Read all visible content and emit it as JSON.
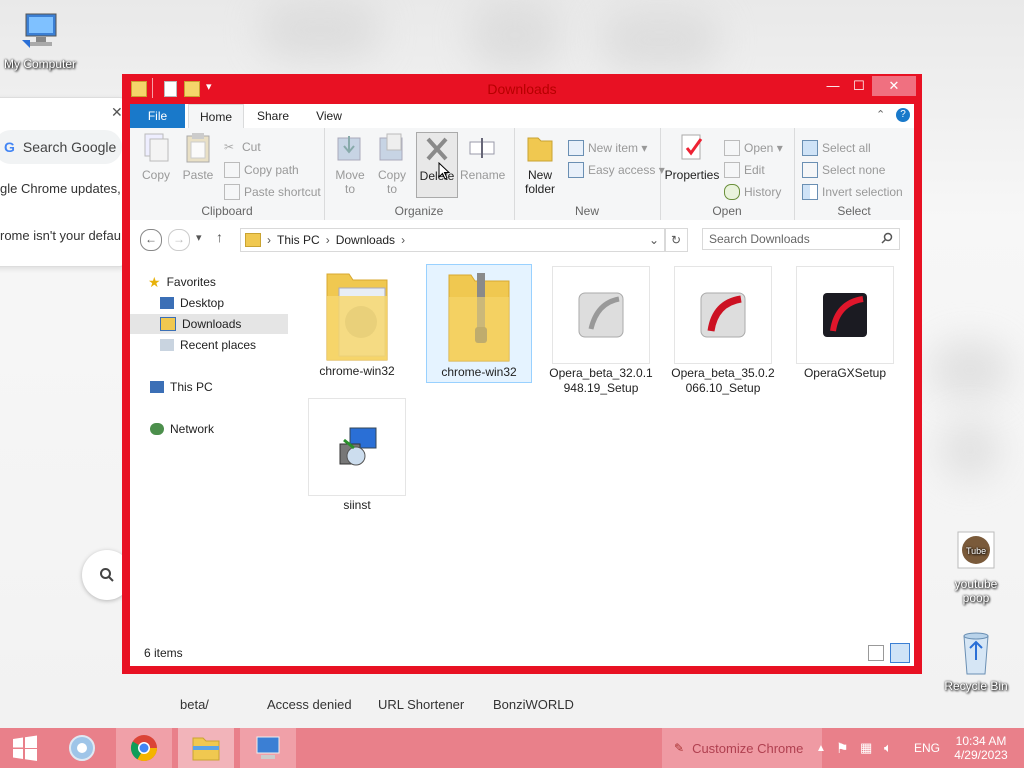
{
  "desktop": {
    "icons": [
      {
        "label": "My Computer"
      },
      {
        "label": "youtube poop"
      },
      {
        "label": "Recycle Bin"
      }
    ]
  },
  "background_chrome": {
    "search_placeholder": "Search Google",
    "line1": "gle Chrome updates,",
    "line2": "rome isn't your defau",
    "close_glyph": "✕",
    "shortcuts": [
      "beta/",
      "Access denied",
      "URL Shortener",
      "BonziWORLD"
    ]
  },
  "window": {
    "title": "Downloads",
    "accent_color": "#e81123",
    "tabs": {
      "file": "File",
      "home": "Home",
      "share": "Share",
      "view": "View"
    },
    "ribbon": {
      "clipboard": {
        "label": "Clipboard",
        "copy": "Copy",
        "paste": "Paste",
        "cut": "Cut",
        "copy_path": "Copy path",
        "paste_shortcut": "Paste shortcut"
      },
      "organize": {
        "label": "Organize",
        "move_to": "Move to",
        "copy_to": "Copy to",
        "delete": "Delete",
        "rename": "Rename"
      },
      "new": {
        "label": "New",
        "new_folder": "New folder",
        "new_item": "New item",
        "easy_access": "Easy access"
      },
      "open": {
        "label": "Open",
        "properties": "Properties",
        "open": "Open",
        "edit": "Edit",
        "history": "History"
      },
      "select": {
        "label": "Select",
        "select_all": "Select all",
        "select_none": "Select none",
        "invert_selection": "Invert selection"
      }
    },
    "address": {
      "crumb1": "This PC",
      "crumb2": "Downloads"
    },
    "search_placeholder": "Search Downloads",
    "nav": {
      "favorites": "Favorites",
      "desktop": "Desktop",
      "downloads": "Downloads",
      "recent": "Recent places",
      "this_pc": "This PC",
      "network": "Network"
    },
    "files": [
      {
        "name": "chrome-win32",
        "icon": "folder-icon"
      },
      {
        "name": "chrome-win32",
        "icon": "zip-folder-icon"
      },
      {
        "name": "Opera_beta_32.0.1948.19_Setup",
        "icon": "opera-installer-icon"
      },
      {
        "name": "Opera_beta_35.0.2066.10_Setup",
        "icon": "opera-installer-icon"
      },
      {
        "name": "OperaGXSetup",
        "icon": "opera-gx-icon"
      },
      {
        "name": "siinst",
        "icon": "installer-icon"
      }
    ],
    "status": "6 items"
  },
  "taskbar": {
    "customize": "Customize Chrome",
    "lang": "ENG",
    "time": "10:34 AM",
    "date": "4/29/2023"
  }
}
